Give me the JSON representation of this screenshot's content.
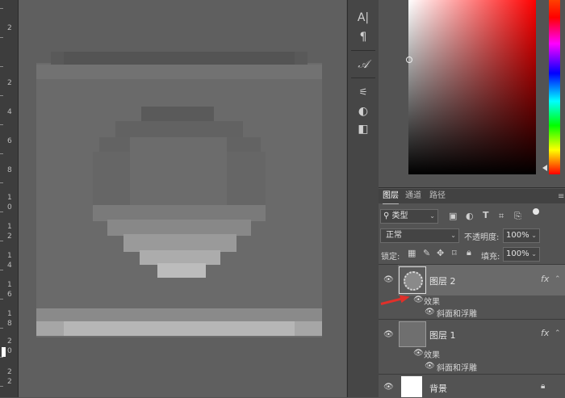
{
  "ruler": {
    "numbers": [
      "2",
      "2",
      "4",
      "6",
      "8",
      "1",
      "0",
      "1",
      "2",
      "1",
      "4",
      "1",
      "6",
      "1",
      "8",
      "2",
      "0",
      "2",
      "2"
    ]
  },
  "tools": {
    "icons": [
      "character-icon",
      "paragraph-icon",
      "glyphs-icon",
      "adjust-icon",
      "contrast-icon",
      "swatch-icon"
    ],
    "glyphs": [
      "A|",
      "¶",
      "𝒜",
      "⚟",
      "◐",
      "◧"
    ]
  },
  "panel": {
    "tabs": [
      "图层",
      "通道",
      "路径"
    ],
    "filter_label": "类型",
    "blend_mode": "正常",
    "opacity_label": "不透明度:",
    "opacity_value": "100%",
    "lock_label": "锁定:",
    "fill_label": "填充:",
    "fill_value": "100%",
    "layers": [
      {
        "name": "图层 2",
        "effects_label": "效果",
        "effect": "斜面和浮雕",
        "fx": "fx"
      },
      {
        "name": "图层 1",
        "effects_label": "效果",
        "effect": "斜面和浮雕",
        "fx": "fx"
      },
      {
        "name": "背景"
      }
    ]
  },
  "colors": {
    "accent_arrow": "#e0302a"
  }
}
